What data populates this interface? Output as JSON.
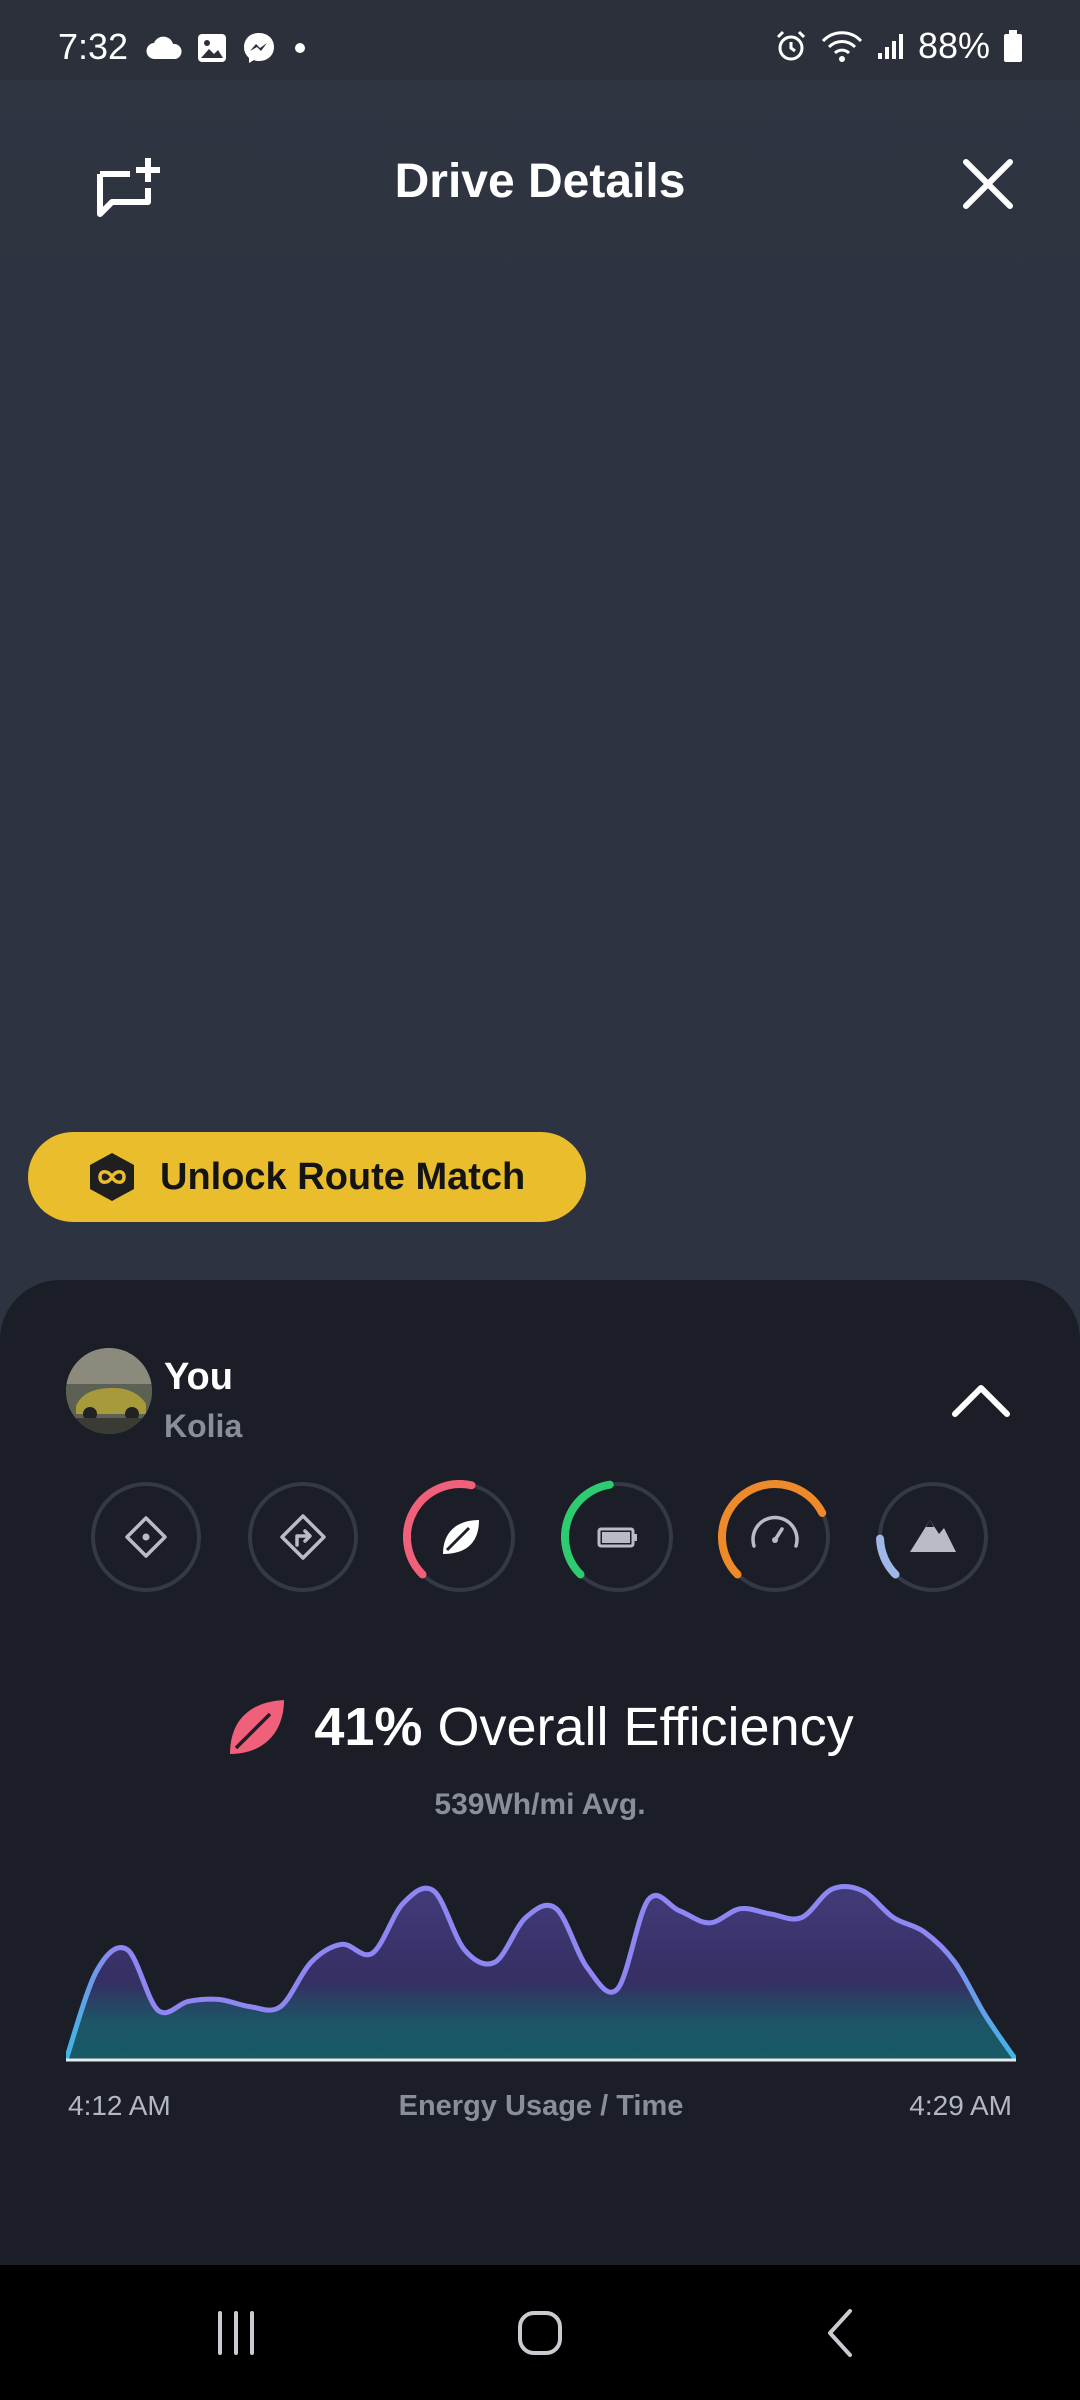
{
  "status_bar": {
    "time": "7:32",
    "left_icons": [
      "cloud-icon",
      "gallery-icon",
      "messenger-icon",
      "dot-icon"
    ],
    "right_icons": [
      "alarm-icon",
      "wifi-icon",
      "signal-icon",
      "battery-icon"
    ],
    "battery": "88%"
  },
  "header": {
    "title": "Drive Details",
    "left_icon": "add-comment-icon",
    "right_icon": "close-icon"
  },
  "route_match": {
    "label": "Unlock Route Match",
    "icon": "infinity-hex-icon"
  },
  "driver": {
    "name": "You",
    "subtitle": "Kolia",
    "expand_icon": "chevron-up-icon"
  },
  "metrics": [
    {
      "name": "distance",
      "icon": "diamond-icon",
      "progress": 0.0,
      "color": "#3a3f4b"
    },
    {
      "name": "turns",
      "icon": "turn-right-icon",
      "progress": 0.0,
      "color": "#3a3f4b"
    },
    {
      "name": "efficiency",
      "icon": "leaf-icon",
      "progress": 0.41,
      "color": "#f0607a"
    },
    {
      "name": "battery",
      "icon": "battery-icon",
      "progress": 0.35,
      "color": "#2ecc71"
    },
    {
      "name": "speed",
      "icon": "speedometer-icon",
      "progress": 0.55,
      "color": "#ef8a2a"
    },
    {
      "name": "elevation",
      "icon": "mountain-icon",
      "progress": 0.12,
      "color": "#9fb8e8"
    }
  ],
  "efficiency": {
    "percent": "41%",
    "label": "Overall Efficiency",
    "avg": "539Wh/mi Avg.",
    "accent": "#f0607a"
  },
  "chart_data": {
    "type": "area",
    "title": "Energy Usage / Time",
    "x_start_label": "4:12 AM",
    "x_end_label": "4:29 AM",
    "values": [
      0,
      50,
      62,
      28,
      33,
      34,
      30,
      30,
      55,
      65,
      60,
      88,
      95,
      62,
      55,
      80,
      85,
      52,
      40,
      90,
      84,
      77,
      85,
      82,
      80,
      96,
      95,
      80,
      72,
      55,
      25,
      0
    ],
    "ylim": [
      0,
      100
    ],
    "line_colors": [
      "#8e86f2",
      "#3fb6e6"
    ],
    "fill_colors": [
      "#3f3a73",
      "#1a5b68"
    ]
  },
  "navbar": {
    "icons": [
      "recents-icon",
      "home-icon",
      "back-icon"
    ]
  }
}
